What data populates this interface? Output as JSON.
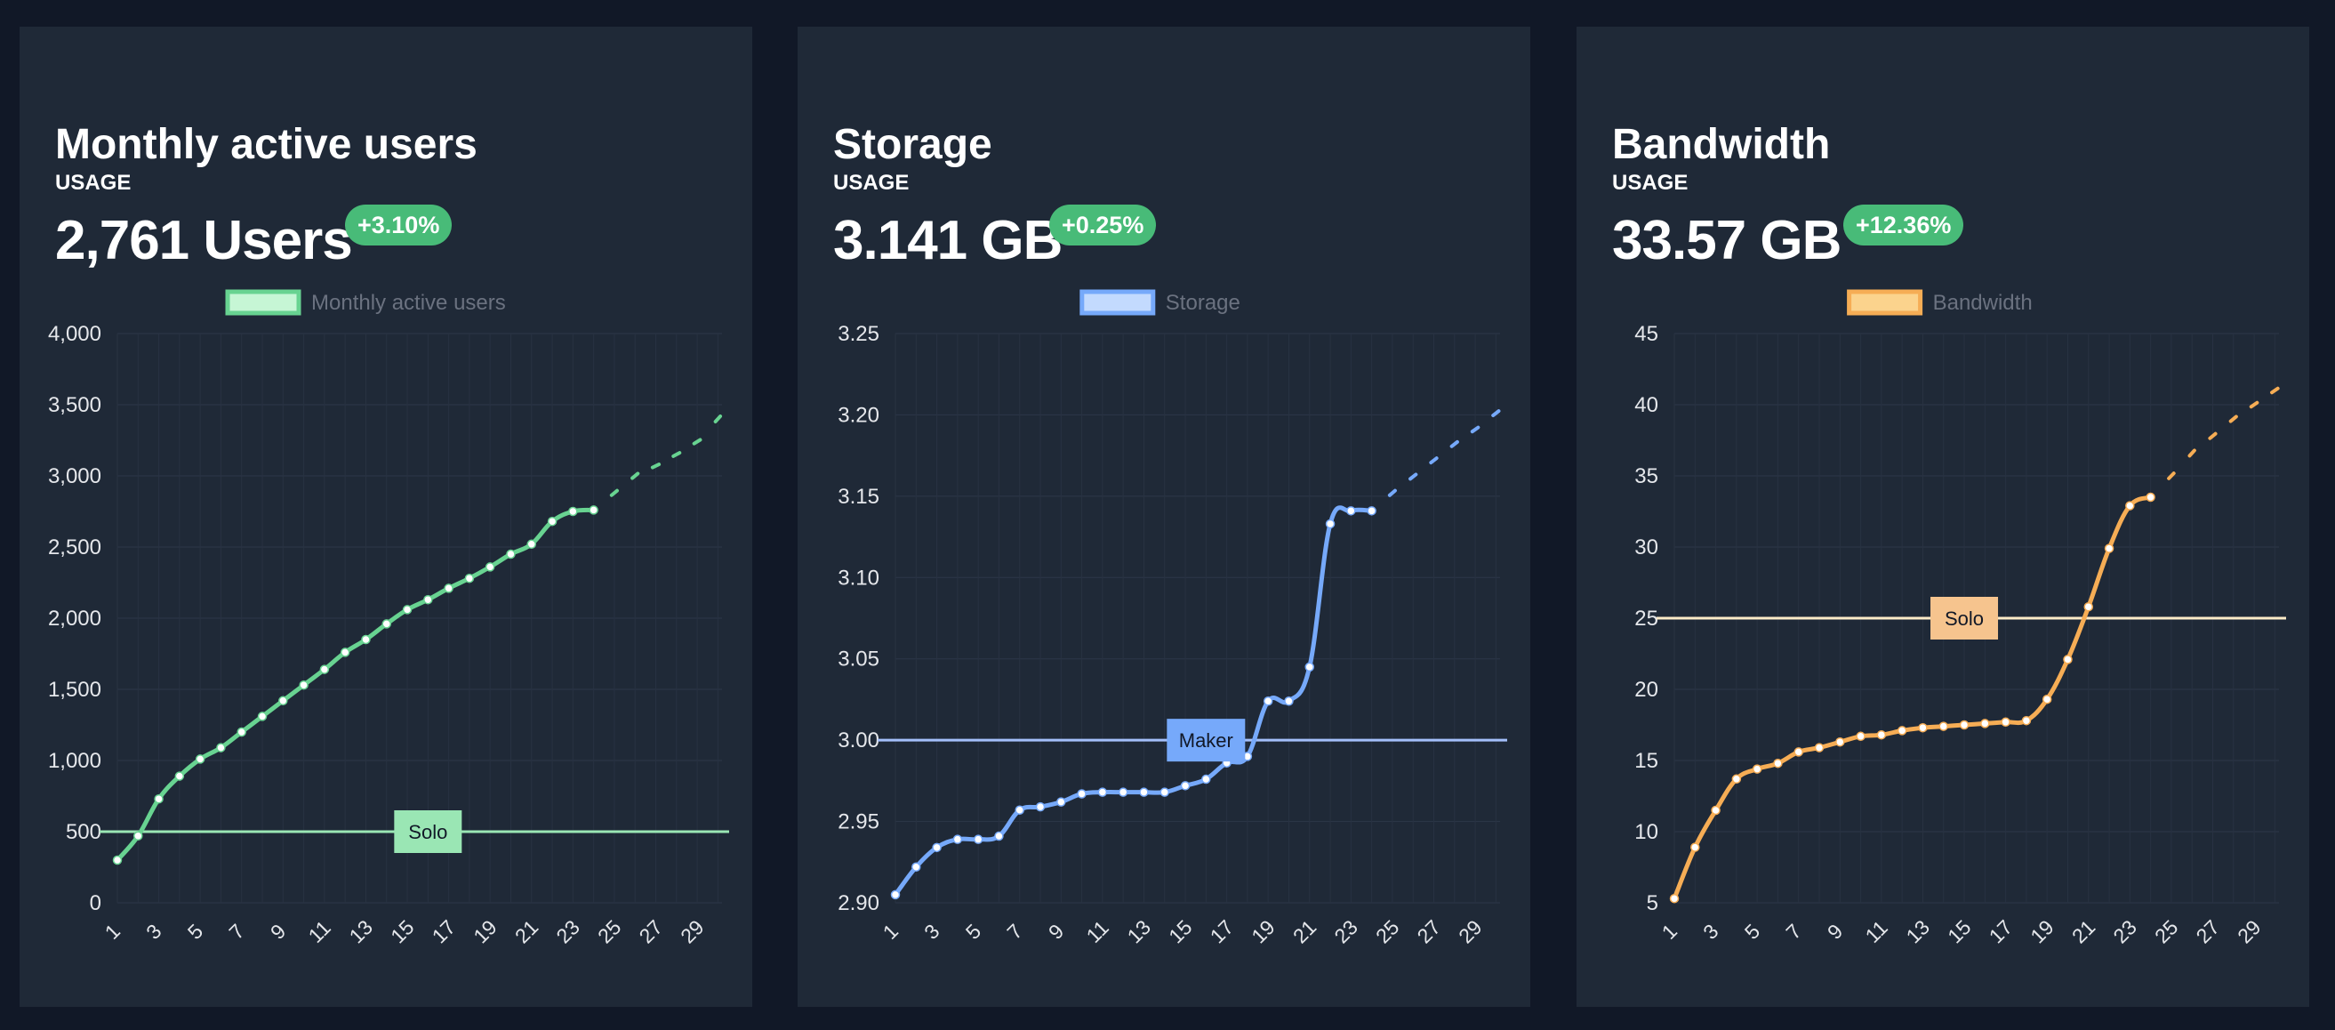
{
  "cards": [
    {
      "title": "Monthly active users",
      "usage_label": "USAGE",
      "value": "2,761 Users",
      "change": "+3.10%"
    },
    {
      "title": "Storage",
      "usage_label": "USAGE",
      "value": "3.141 GB",
      "change": "+0.25%"
    },
    {
      "title": "Bandwidth",
      "usage_label": "USAGE",
      "value": "33.57 GB",
      "change": "+12.36%"
    }
  ],
  "chart_data": [
    {
      "type": "line",
      "legend": "Monthly active users",
      "color": "#68d391",
      "fill": "#c6f6d5",
      "x": [
        1,
        2,
        3,
        4,
        5,
        6,
        7,
        8,
        9,
        10,
        11,
        12,
        13,
        14,
        15,
        16,
        17,
        18,
        19,
        20,
        21,
        22,
        23,
        24
      ],
      "values": [
        300,
        470,
        730,
        890,
        1010,
        1090,
        1200,
        1310,
        1420,
        1530,
        1640,
        1760,
        1850,
        1960,
        2060,
        2130,
        2210,
        2280,
        2360,
        2450,
        2520,
        2680,
        2750,
        2760
      ],
      "forecast_x": [
        25,
        26,
        27,
        28,
        29,
        30
      ],
      "forecast_values": [
        2880,
        3000,
        3070,
        3150,
        3240,
        3400
      ],
      "xticks": [
        1,
        3,
        5,
        7,
        9,
        11,
        13,
        15,
        17,
        19,
        21,
        23,
        25,
        27,
        29
      ],
      "yticks": [
        "0",
        "500",
        "1,000",
        "1,500",
        "2,000",
        "2,500",
        "3,000",
        "3,500",
        "4,000"
      ],
      "ytick_values": [
        0,
        500,
        1000,
        1500,
        2000,
        2500,
        3000,
        3500,
        4000
      ],
      "ylim": [
        0,
        4000
      ],
      "threshold": {
        "value": 500,
        "label": "Solo",
        "at_x": 16,
        "color": "#9ae6b4",
        "box": "#9ae6b4"
      }
    },
    {
      "type": "line",
      "legend": "Storage",
      "color": "#76a9fa",
      "fill": "#c3dafe",
      "x": [
        1,
        2,
        3,
        4,
        5,
        6,
        7,
        8,
        9,
        10,
        11,
        12,
        13,
        14,
        15,
        16,
        17,
        18,
        19,
        20,
        21,
        22,
        23,
        24
      ],
      "values": [
        2.905,
        2.922,
        2.934,
        2.939,
        2.939,
        2.941,
        2.957,
        2.959,
        2.962,
        2.967,
        2.968,
        2.968,
        2.968,
        2.968,
        2.972,
        2.976,
        2.986,
        2.99,
        3.024,
        3.024,
        3.045,
        3.133,
        3.141,
        3.141
      ],
      "forecast_x": [
        25,
        26,
        27,
        28,
        29,
        30
      ],
      "forecast_values": [
        3.152,
        3.162,
        3.172,
        3.182,
        3.191,
        3.201
      ],
      "xticks": [
        1,
        3,
        5,
        7,
        9,
        11,
        13,
        15,
        17,
        19,
        21,
        23,
        25,
        27,
        29
      ],
      "yticks": [
        "2.90",
        "2.95",
        "3.00",
        "3.05",
        "3.10",
        "3.15",
        "3.20",
        "3.25"
      ],
      "ytick_values": [
        2.9,
        2.95,
        3.0,
        3.05,
        3.1,
        3.15,
        3.2,
        3.25
      ],
      "ylim": [
        2.9,
        3.25
      ],
      "threshold": {
        "value": 3.0,
        "label": "Maker",
        "at_x": 16,
        "color": "#a3bffa",
        "box": "#76a9fa"
      }
    },
    {
      "type": "line",
      "legend": "Bandwidth",
      "color": "#f6ad55",
      "fill": "#fbd38d",
      "x": [
        1,
        2,
        3,
        4,
        5,
        6,
        7,
        8,
        9,
        10,
        11,
        12,
        13,
        14,
        15,
        16,
        17,
        18,
        19,
        20,
        21,
        22,
        23,
        24
      ],
      "values": [
        5.3,
        8.9,
        11.5,
        13.7,
        14.4,
        14.8,
        15.6,
        15.9,
        16.3,
        16.7,
        16.8,
        17.1,
        17.3,
        17.4,
        17.5,
        17.6,
        17.7,
        17.8,
        19.3,
        22.1,
        25.8,
        29.9,
        32.9,
        33.5
      ],
      "forecast_x": [
        25,
        26,
        27,
        28,
        29,
        30
      ],
      "forecast_values": [
        35.0,
        36.6,
        37.8,
        39.0,
        40.0,
        41.0
      ],
      "xticks": [
        1,
        3,
        5,
        7,
        9,
        11,
        13,
        15,
        17,
        19,
        21,
        23,
        25,
        27,
        29
      ],
      "yticks": [
        "5",
        "10",
        "15",
        "20",
        "25",
        "30",
        "35",
        "40",
        "45"
      ],
      "ytick_values": [
        5,
        10,
        15,
        20,
        25,
        30,
        35,
        40,
        45
      ],
      "ylim": [
        5,
        45
      ],
      "threshold": {
        "value": 25,
        "label": "Solo",
        "at_x": 15,
        "color": "#feebc8",
        "box": "#f6c48e"
      }
    }
  ]
}
